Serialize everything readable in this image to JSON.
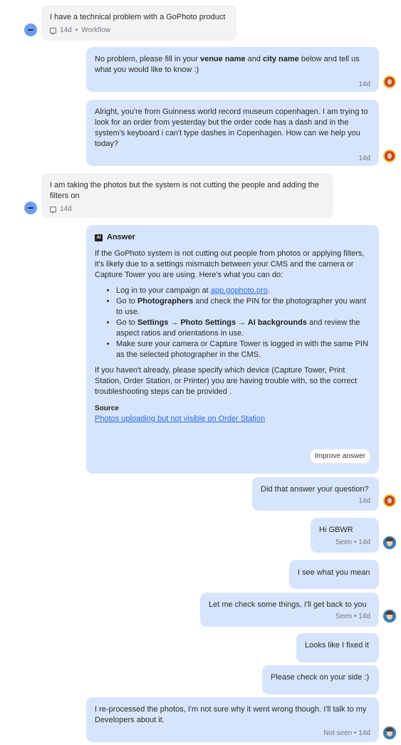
{
  "messages": {
    "m1": {
      "text": "I have a technical problem with a GoPhoto product",
      "time": "14d",
      "channel": "Workflow"
    },
    "m2": {
      "p1": "No problem, please fill in your ",
      "venue": "venue name",
      "p2": " and ",
      "city": "city name",
      "p3": " below and tell us what you would like to know :)",
      "time": "14d"
    },
    "m3": {
      "text": "Alright, you're from Guinness world record museum copenhagen. I am trying to look for an order from yesterday but the order code has a dash and in the system's keyboard i can't type dashes in Copenhagen. How can we help you today?",
      "time": "14d"
    },
    "m4": {
      "text": "I am taking the photos but the system is not cutting the people and adding the filters on",
      "time": "14d"
    },
    "answer": {
      "icon_label": "AI",
      "title": "Answer",
      "intro": "If the GoPhoto system is not cutting out people from photos or applying filters, it's likely due to a settings mismatch between your CMS and the camera or Capture Tower you are using. Here's what you can do:",
      "b1_pre": "Log in to your campaign at ",
      "b1_link": "app.gophoto.pro",
      "b1_post": ".",
      "b2_pre": "Go to ",
      "b2_bold": "Photographers",
      "b2_post": " and check the PIN for the photographer you want to use.",
      "b3_pre": "Go to ",
      "b3_bold": "Settings → Photo Settings → AI backgrounds",
      "b3_post": " and review the aspect ratios and orientations in use.",
      "b4": "Make sure your camera or Capture Tower is logged in with the same PIN as the selected photographer in the CMS.",
      "outro": "If you haven't already, please specify which device (Capture Tower, Print Station, Order Station, or Printer) you are having trouble with, so the correct troubleshooting steps can be provided .",
      "source_label": "Source",
      "source_link": "Photos uploading but not visible on Order Station",
      "improve_label": "Improve answer"
    },
    "m5": {
      "text": "Did that answer your question?",
      "time": "14d"
    },
    "m6": {
      "text": "Hi GBWR",
      "status": "Seen • 14d"
    },
    "m7": {
      "text": "I see what you mean"
    },
    "m8": {
      "text": "Let me check some things, I'll get back to you",
      "status": "Seen • 14d"
    },
    "m9": {
      "text": "Looks like I fixed it"
    },
    "m10": {
      "text": "Please check on your side :)"
    },
    "m11": {
      "text": "I re-processed the photos, I'm not sure why it went wrong though. I'll talk to my Developers about it.",
      "status": "Not seen • 14d"
    }
  }
}
